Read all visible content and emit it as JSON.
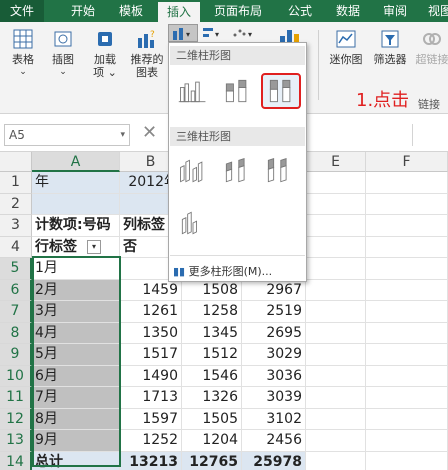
{
  "tabs": [
    {
      "label": "文件"
    },
    {
      "label": "开始"
    },
    {
      "label": "模板"
    },
    {
      "label": "插入"
    },
    {
      "label": "页面布局"
    },
    {
      "label": "公式"
    },
    {
      "label": "数据"
    },
    {
      "label": "审阅"
    },
    {
      "label": "视图"
    }
  ],
  "ribbon": {
    "table": "表格",
    "illustrations": "插图",
    "addin_line1": "加载",
    "addin_line2": "项",
    "recommended_line1": "推荐的",
    "recommended_line2": "图表",
    "slicer_fragment": "迷你图",
    "filter": "筛选器",
    "hyperlink": "超链接",
    "link_fragment": "链接"
  },
  "formula_bar": {
    "name_box": "A5",
    "cancel_glyph": "✕"
  },
  "dropdown": {
    "section_2d": "二维柱形图",
    "section_3d": "三维柱形图",
    "more_charts": "更多柱形图(M)..."
  },
  "annotation": {
    "text": "1.点击"
  },
  "sheet": {
    "columns": [
      "A",
      "B",
      "C",
      "D",
      "E",
      "F"
    ],
    "rows": [
      {
        "num": "1",
        "a": "年",
        "b": "2012年"
      },
      {
        "num": "2",
        "a": "",
        "b": ""
      },
      {
        "num": "3",
        "a": "计数项:号码",
        "b": "列标签"
      },
      {
        "num": "4",
        "a": "行标签",
        "b": "否"
      },
      {
        "num": "5",
        "a": "1月",
        "b": "1",
        "c": "",
        "d": ""
      },
      {
        "num": "6",
        "a": "2月",
        "b": "1459",
        "c": "1508",
        "d": "2967"
      },
      {
        "num": "7",
        "a": "3月",
        "b": "1261",
        "c": "1258",
        "d": "2519"
      },
      {
        "num": "8",
        "a": "4月",
        "b": "1350",
        "c": "1345",
        "d": "2695"
      },
      {
        "num": "9",
        "a": "5月",
        "b": "1517",
        "c": "1512",
        "d": "3029"
      },
      {
        "num": "10",
        "a": "6月",
        "b": "1490",
        "c": "1546",
        "d": "3036"
      },
      {
        "num": "11",
        "a": "7月",
        "b": "1713",
        "c": "1326",
        "d": "3039"
      },
      {
        "num": "12",
        "a": "8月",
        "b": "1597",
        "c": "1505",
        "d": "3102"
      },
      {
        "num": "13",
        "a": "9月",
        "b": "1252",
        "c": "1204",
        "d": "2456"
      },
      {
        "num": "14",
        "a": "总计",
        "b": "13213",
        "c": "12765",
        "d": "25978"
      }
    ]
  },
  "colors": {
    "accent": "#217346",
    "highlight": "#e02020",
    "shaded": "#c0c0c0"
  }
}
